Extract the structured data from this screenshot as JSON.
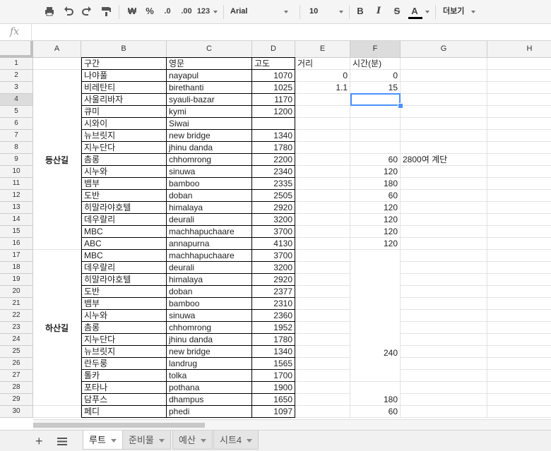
{
  "toolbar": {
    "currency": "₩",
    "percent": "%",
    "decrease_decimal": ".0",
    "increase_decimal": ".00",
    "number_format": "123",
    "font": "Arial",
    "font_size": "10",
    "bold": "B",
    "italic": "I",
    "strike": "S",
    "text_color": "A",
    "more": "더보기"
  },
  "formula_bar": {
    "fx": "fx",
    "value": ""
  },
  "columns": [
    "A",
    "B",
    "C",
    "D",
    "E",
    "F",
    "G",
    "H"
  ],
  "rows": [
    "1",
    "2",
    "3",
    "4",
    "5",
    "6",
    "7",
    "8",
    "9",
    "10",
    "11",
    "12",
    "13",
    "14",
    "15",
    "16",
    "17",
    "18",
    "19",
    "20",
    "21",
    "22",
    "23",
    "24",
    "25",
    "26",
    "27",
    "28",
    "29",
    "30"
  ],
  "header": {
    "B": "구간",
    "C": "영문",
    "D": "고도",
    "E": "거리",
    "F": "시간(분)"
  },
  "groups": {
    "ascent": "등산길",
    "descent": "하산길"
  },
  "data": [
    {
      "B": "나야풀",
      "C": "nayapul",
      "D": "1070",
      "E": "0",
      "F": "0"
    },
    {
      "B": "비레탄티",
      "C": "birethanti",
      "D": "1025",
      "E": "1.1",
      "F": "15"
    },
    {
      "B": "사울리바자",
      "C": "syauli-bazar",
      "D": "1170",
      "E": "",
      "F": ""
    },
    {
      "B": "큐미",
      "C": "kymi",
      "D": "1200",
      "E": "",
      "F": ""
    },
    {
      "B": "시와이",
      "C": "Siwai",
      "D": "",
      "E": "",
      "F": ""
    },
    {
      "B": "뉴브릿지",
      "C": "new bridge",
      "D": "1340",
      "E": "",
      "F": ""
    },
    {
      "B": "지누단다",
      "C": "jhinu danda",
      "D": "1780",
      "E": "",
      "F": ""
    },
    {
      "B": "촘롱",
      "C": "chhomrong",
      "D": "2200",
      "E": "",
      "F": "60",
      "G": "2800여 계단"
    },
    {
      "B": "시누와",
      "C": "sinuwa",
      "D": "2340",
      "E": "",
      "F": "120"
    },
    {
      "B": "뱀부",
      "C": "bamboo",
      "D": "2335",
      "E": "",
      "F": "180"
    },
    {
      "B": "도반",
      "C": "doban",
      "D": "2505",
      "E": "",
      "F": "60"
    },
    {
      "B": "히말라야호텔",
      "C": "himalaya",
      "D": "2920",
      "E": "",
      "F": "120"
    },
    {
      "B": "데우랄리",
      "C": "deurali",
      "D": "3200",
      "E": "",
      "F": "120"
    },
    {
      "B": "MBC",
      "C": "machhapuchaare",
      "D": "3700",
      "E": "",
      "F": "120"
    },
    {
      "B": "ABC",
      "C": "annapurna",
      "D": "4130",
      "E": "",
      "F": "120"
    },
    {
      "B": "MBC",
      "C": "machhapuchaare",
      "D": "3700",
      "E": "",
      "F": ""
    },
    {
      "B": "데우랄리",
      "C": "deurali",
      "D": "3200",
      "E": "",
      "F": ""
    },
    {
      "B": "히말라야호텔",
      "C": "himalaya",
      "D": "2920",
      "E": "",
      "F": ""
    },
    {
      "B": "도반",
      "C": "doban",
      "D": "2377",
      "E": "",
      "F": ""
    },
    {
      "B": "뱀부",
      "C": "bamboo",
      "D": "2310",
      "E": "",
      "F": ""
    },
    {
      "B": "시누와",
      "C": "sinuwa",
      "D": "2360",
      "E": "",
      "F": ""
    },
    {
      "B": "촘롱",
      "C": "chhomrong",
      "D": "1952",
      "E": "",
      "F": ""
    },
    {
      "B": "지누단다",
      "C": "jhinu danda",
      "D": "1780",
      "E": "",
      "F": ""
    },
    {
      "B": "뉴브릿지",
      "C": "new bridge",
      "D": "1340",
      "E": "",
      "F": ""
    },
    {
      "B": "란두룽",
      "C": "landrug",
      "D": "1565",
      "E": "",
      "F": ""
    },
    {
      "B": "톨카",
      "C": "tolka",
      "D": "1700",
      "E": "",
      "F": ""
    },
    {
      "B": "포타나",
      "C": "pothana",
      "D": "1900",
      "E": "",
      "F": ""
    },
    {
      "B": "담푸스",
      "C": "dhampus",
      "D": "1650",
      "E": "",
      "F": ""
    },
    {
      "B": "페디",
      "C": "phedi",
      "D": "1097",
      "E": "",
      "F": "60"
    }
  ],
  "merged_f": [
    {
      "value": "240"
    },
    {
      "value": "180"
    }
  ],
  "tabs": [
    {
      "label": "루트",
      "active": true
    },
    {
      "label": "준비물",
      "active": false
    },
    {
      "label": "예산",
      "active": false
    },
    {
      "label": "시트4",
      "active": false
    }
  ]
}
